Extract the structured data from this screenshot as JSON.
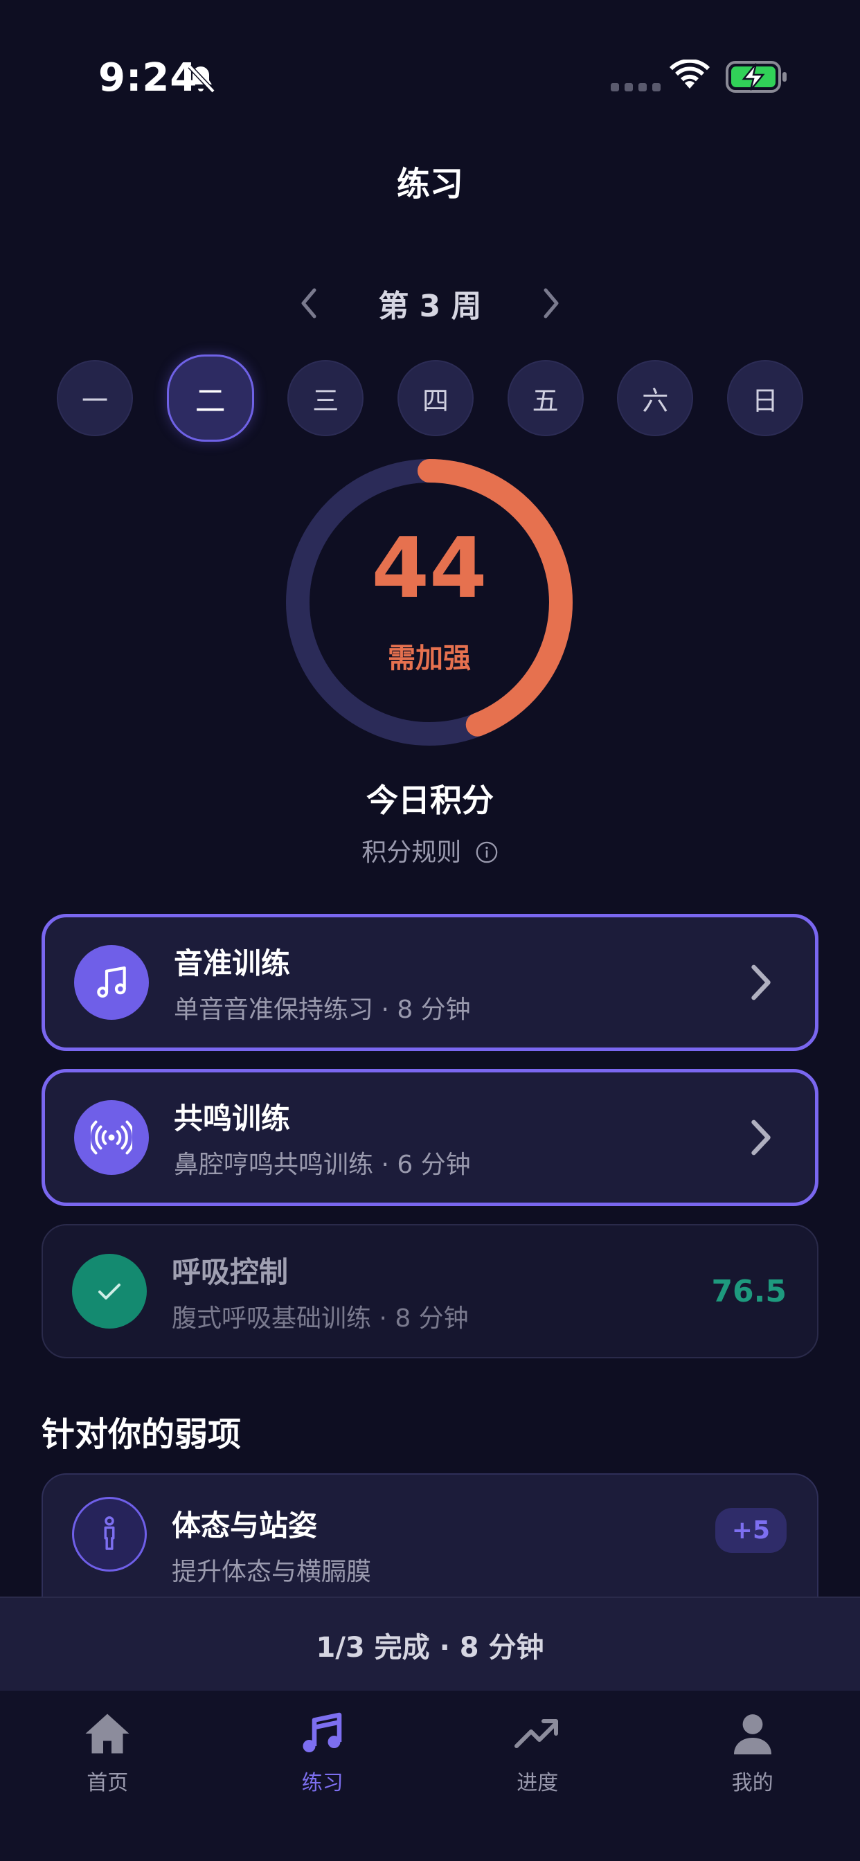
{
  "status_bar": {
    "time": "9:24",
    "icons": [
      "bell-slash-icon",
      "signal-icon",
      "wifi-icon",
      "battery-charging-icon"
    ]
  },
  "page": {
    "title": "练习"
  },
  "week": {
    "label": "第 3 周",
    "prev_icon": "chevron-left-icon",
    "next_icon": "chevron-right-icon"
  },
  "days": [
    {
      "label": "一",
      "selected": false
    },
    {
      "label": "二",
      "selected": true
    },
    {
      "label": "三",
      "selected": false
    },
    {
      "label": "四",
      "selected": false
    },
    {
      "label": "五",
      "selected": false
    },
    {
      "label": "六",
      "selected": false
    },
    {
      "label": "日",
      "selected": false
    }
  ],
  "score": {
    "value": "44",
    "progress": 0.44,
    "status": "需加强",
    "label": "今日积分",
    "rules_link": "积分规则",
    "color": "#e6714f"
  },
  "exercises": [
    {
      "title": "音准训练",
      "subtitle": "单音音准保持练习 · 8 分钟",
      "icon": "music-note-icon",
      "state": "pending"
    },
    {
      "title": "共鸣训练",
      "subtitle": "鼻腔哼鸣共鸣训练 · 6 分钟",
      "icon": "broadcast-icon",
      "state": "pending"
    },
    {
      "title": "呼吸控制",
      "subtitle": "腹式呼吸基础训练 · 8 分钟",
      "icon": "check-icon",
      "state": "done",
      "score": "76.5"
    }
  ],
  "weakness": {
    "section_title": "针对你的弱项",
    "items": [
      {
        "title": "体态与站姿",
        "subtitle": "提升体态与横膈膜",
        "icon": "person-standing-icon",
        "badge": "+5"
      }
    ]
  },
  "summary": {
    "text": "1/3 完成 · 8 分钟"
  },
  "tabs": [
    {
      "label": "首页",
      "icon": "home-icon",
      "active": false
    },
    {
      "label": "练习",
      "icon": "music-note-icon",
      "active": true
    },
    {
      "label": "进度",
      "icon": "trend-up-icon",
      "active": false
    },
    {
      "label": "我的",
      "icon": "profile-icon",
      "active": false
    }
  ],
  "colors": {
    "accent": "#7a67f0",
    "warning": "#e6714f",
    "success": "#1e9a7e",
    "background": "#0e0e22"
  }
}
